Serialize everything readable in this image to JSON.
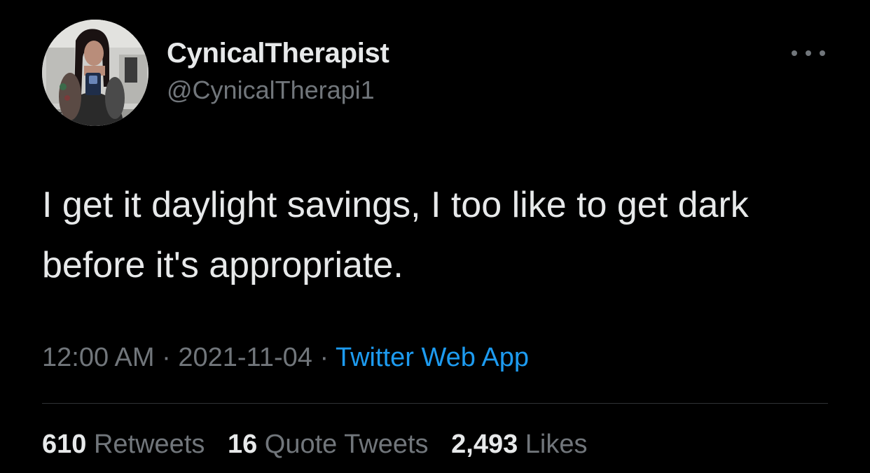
{
  "tweet": {
    "author": {
      "display_name": "CynicalTherapist",
      "handle": "@CynicalTherapi1",
      "avatar_icon": "profile-photo"
    },
    "more_icon": "more-options-icon",
    "text": "I get it daylight savings, I too like to get dark before it's appropriate.",
    "time": "12:00 AM",
    "date": "2021-11-04",
    "separator": "·",
    "source": "Twitter Web App",
    "stats": {
      "retweets": {
        "count": "610",
        "label": "Retweets"
      },
      "quote_tweets": {
        "count": "16",
        "label": "Quote Tweets"
      },
      "likes": {
        "count": "2,493",
        "label": "Likes"
      }
    }
  },
  "colors": {
    "background": "#000000",
    "primary_text": "#e7e9ea",
    "secondary_text": "#71767b",
    "link": "#1d9bf0",
    "divider": "#2f3336"
  }
}
